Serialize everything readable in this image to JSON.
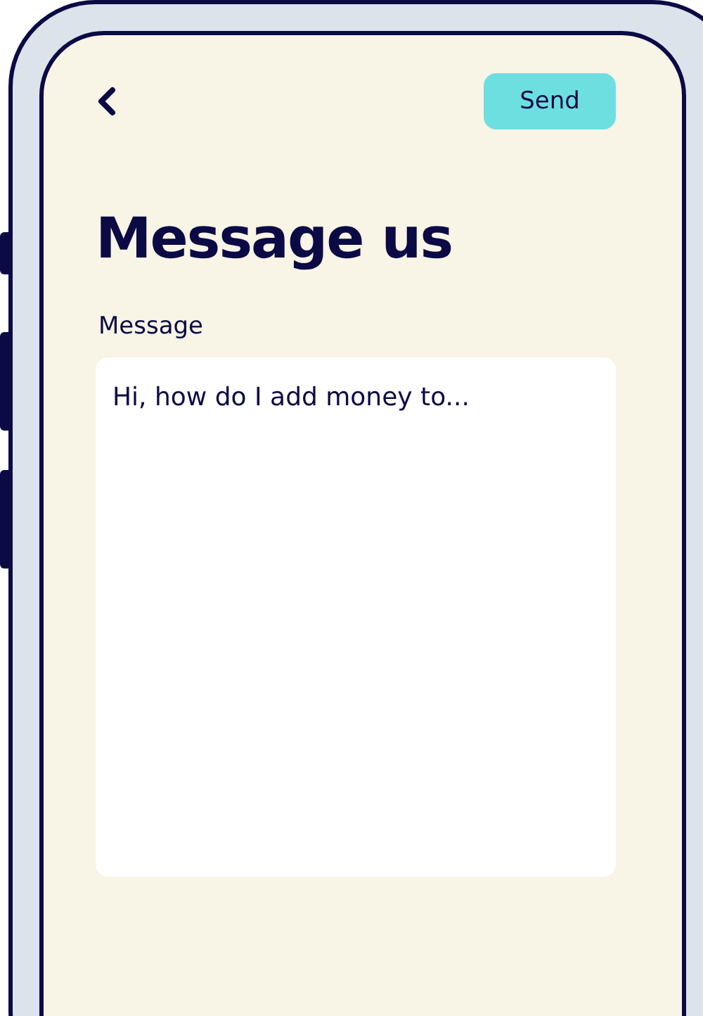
{
  "top_bar": {
    "send_button": "Send"
  },
  "title": "Message us",
  "message_field": {
    "label": "Message",
    "value": "Hi, how do I add money to..."
  }
}
